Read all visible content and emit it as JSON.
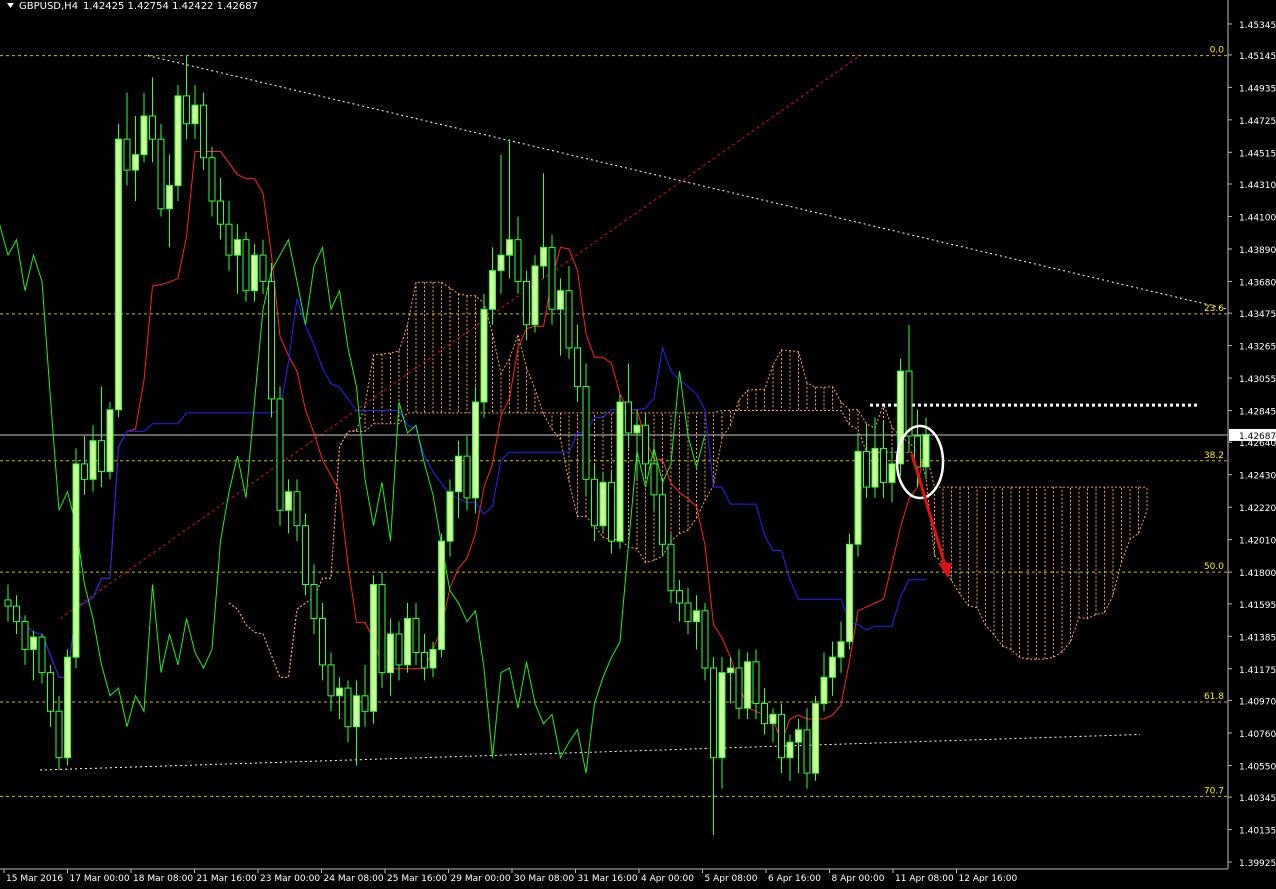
{
  "window": {
    "symbol_label": "GBPUSD,H4",
    "ohlc": "1.42425 1.42754 1.42422 1.42687",
    "collapse_icon": "triangle-down-icon"
  },
  "colors": {
    "background": "#000000",
    "bull_candle": "#ccff99",
    "candle_wick": "#33ff33",
    "tenkan": "#ff2222",
    "kijun": "#2222ff",
    "chikou": "#22ee22",
    "kumo": "#ffa050",
    "fibo": "#ffee00",
    "trendline": "#ffffff",
    "annotation_arrow": "#dd1111",
    "annotation_circle": "#ffffff",
    "price_line": "#c8c8c8"
  },
  "chart_data": {
    "type": "candlestick",
    "timeframe": "H4",
    "ylim": [
      1.3988,
      1.455
    ],
    "price_axis_ticks": [
      "1.45345",
      "1.45145",
      "1.44935",
      "1.44725",
      "1.44515",
      "1.44310",
      "1.44100",
      "1.43890",
      "1.43680",
      "1.43475",
      "1.43265",
      "1.43055",
      "1.42845",
      "1.42640",
      "1.42430",
      "1.42220",
      "1.42010",
      "1.41800",
      "1.41595",
      "1.41385",
      "1.41175",
      "1.40970",
      "1.40760",
      "1.40550",
      "1.40345",
      "1.40135",
      "1.39925"
    ],
    "current_price": {
      "label": "1.42687",
      "value": 1.42687
    },
    "time_axis_ticks": [
      "15 Mar 2016",
      "17 Mar 00:00",
      "18 Mar 08:00",
      "21 Mar 16:00",
      "23 Mar 00:00",
      "24 Mar 08:00",
      "25 Mar 16:00",
      "29 Mar 00:00",
      "30 Mar 08:00",
      "31 Mar 16:00",
      "4 Apr 00:00",
      "5 Apr 08:00",
      "6 Apr 16:00",
      "8 Apr 00:00",
      "11 Apr 08:00",
      "12 Apr 16:00"
    ],
    "fibonacci_levels": [
      {
        "label": "0.0",
        "value": 1.4514
      },
      {
        "label": "23.6",
        "value": 1.4347
      },
      {
        "label": "38.2",
        "value": 1.4252
      },
      {
        "label": "50.0",
        "value": 1.418
      },
      {
        "label": "61.8",
        "value": 1.4096
      },
      {
        "label": "70.7",
        "value": 1.4035
      }
    ],
    "candles": [
      [
        1.4162,
        1.4172,
        1.4148,
        1.4158
      ],
      [
        1.4158,
        1.4165,
        1.414,
        1.4148
      ],
      [
        1.4148,
        1.4152,
        1.412,
        1.413
      ],
      [
        1.413,
        1.4142,
        1.411,
        1.4138
      ],
      [
        1.4138,
        1.414,
        1.4108,
        1.4115
      ],
      [
        1.4115,
        1.412,
        1.408,
        1.409
      ],
      [
        1.409,
        1.41,
        1.4052,
        1.406
      ],
      [
        1.406,
        1.413,
        1.4055,
        1.4125
      ],
      [
        1.4125,
        1.426,
        1.4118,
        1.425
      ],
      [
        1.425,
        1.4268,
        1.423,
        1.424
      ],
      [
        1.424,
        1.4275,
        1.4232,
        1.4265
      ],
      [
        1.4265,
        1.43,
        1.4235,
        1.4245
      ],
      [
        1.4245,
        1.429,
        1.424,
        1.4285
      ],
      [
        1.4285,
        1.447,
        1.428,
        1.446
      ],
      [
        1.446,
        1.449,
        1.443,
        1.444
      ],
      [
        1.444,
        1.4475,
        1.442,
        1.445
      ],
      [
        1.445,
        1.449,
        1.4445,
        1.4475
      ],
      [
        1.4475,
        1.45,
        1.4445,
        1.446
      ],
      [
        1.446,
        1.447,
        1.441,
        1.4415
      ],
      [
        1.4415,
        1.445,
        1.439,
        1.443
      ],
      [
        1.443,
        1.4495,
        1.442,
        1.4488
      ],
      [
        1.4488,
        1.4514,
        1.446,
        1.447
      ],
      [
        1.447,
        1.4495,
        1.446,
        1.4482
      ],
      [
        1.4482,
        1.449,
        1.444,
        1.4448
      ],
      [
        1.4448,
        1.4455,
        1.441,
        1.442
      ],
      [
        1.442,
        1.4435,
        1.4395,
        1.4405
      ],
      [
        1.4405,
        1.442,
        1.4375,
        1.4385
      ],
      [
        1.4385,
        1.4405,
        1.436,
        1.4395
      ],
      [
        1.4395,
        1.44,
        1.4355,
        1.4362
      ],
      [
        1.4362,
        1.4392,
        1.4355,
        1.4385
      ],
      [
        1.4385,
        1.4395,
        1.436,
        1.4368
      ],
      [
        1.4368,
        1.438,
        1.428,
        1.4292
      ],
      [
        1.4292,
        1.43,
        1.421,
        1.422
      ],
      [
        1.422,
        1.424,
        1.4205,
        1.4232
      ],
      [
        1.4232,
        1.424,
        1.42,
        1.421
      ],
      [
        1.421,
        1.4218,
        1.4165,
        1.4172
      ],
      [
        1.4172,
        1.4185,
        1.414,
        1.415
      ],
      [
        1.415,
        1.416,
        1.411,
        1.412
      ],
      [
        1.412,
        1.4128,
        1.409,
        1.41
      ],
      [
        1.41,
        1.4112,
        1.4085,
        1.4105
      ],
      [
        1.4105,
        1.411,
        1.407,
        1.408
      ],
      [
        1.408,
        1.411,
        1.4055,
        1.41
      ],
      [
        1.41,
        1.412,
        1.408,
        1.409
      ],
      [
        1.409,
        1.4178,
        1.4082,
        1.4172
      ],
      [
        1.4172,
        1.418,
        1.4105,
        1.4115
      ],
      [
        1.4115,
        1.415,
        1.41,
        1.414
      ],
      [
        1.414,
        1.4148,
        1.411,
        1.412
      ],
      [
        1.412,
        1.416,
        1.4115,
        1.415
      ],
      [
        1.415,
        1.416,
        1.412,
        1.4128
      ],
      [
        1.4128,
        1.414,
        1.411,
        1.4118
      ],
      [
        1.4118,
        1.4135,
        1.4112,
        1.413
      ],
      [
        1.413,
        1.4205,
        1.4125,
        1.42
      ],
      [
        1.42,
        1.424,
        1.419,
        1.4232
      ],
      [
        1.4232,
        1.4265,
        1.4215,
        1.4255
      ],
      [
        1.4255,
        1.4268,
        1.422,
        1.4228
      ],
      [
        1.4228,
        1.43,
        1.4218,
        1.429
      ],
      [
        1.429,
        1.436,
        1.428,
        1.435
      ],
      [
        1.435,
        1.439,
        1.434,
        1.4375
      ],
      [
        1.4375,
        1.445,
        1.436,
        1.4385
      ],
      [
        1.4385,
        1.446,
        1.437,
        1.4395
      ],
      [
        1.4395,
        1.441,
        1.436,
        1.4368
      ],
      [
        1.4368,
        1.4375,
        1.433,
        1.434
      ],
      [
        1.434,
        1.4385,
        1.4335,
        1.4378
      ],
      [
        1.4378,
        1.4438,
        1.437,
        1.439
      ],
      [
        1.439,
        1.4398,
        1.434,
        1.435
      ],
      [
        1.435,
        1.437,
        1.432,
        1.4362
      ],
      [
        1.4362,
        1.4378,
        1.4318,
        1.4325
      ],
      [
        1.4325,
        1.434,
        1.429,
        1.43
      ],
      [
        1.43,
        1.4315,
        1.423,
        1.424
      ],
      [
        1.424,
        1.425,
        1.42,
        1.421
      ],
      [
        1.421,
        1.4245,
        1.4205,
        1.4238
      ],
      [
        1.4238,
        1.4245,
        1.4192,
        1.42
      ],
      [
        1.42,
        1.4295,
        1.4195,
        1.429
      ],
      [
        1.429,
        1.4315,
        1.426,
        1.427
      ],
      [
        1.427,
        1.4285,
        1.424,
        1.4275
      ],
      [
        1.4275,
        1.4282,
        1.424,
        1.425
      ],
      [
        1.425,
        1.4265,
        1.422,
        1.423
      ],
      [
        1.423,
        1.424,
        1.419,
        1.4198
      ],
      [
        1.4198,
        1.4205,
        1.416,
        1.4168
      ],
      [
        1.4168,
        1.4175,
        1.4148,
        1.416
      ],
      [
        1.416,
        1.417,
        1.414,
        1.4148
      ],
      [
        1.4148,
        1.4165,
        1.413,
        1.4155
      ],
      [
        1.4155,
        1.416,
        1.411,
        1.4118
      ],
      [
        1.4118,
        1.4125,
        1.401,
        1.406
      ],
      [
        1.406,
        1.4125,
        1.404,
        1.4115
      ],
      [
        1.4115,
        1.4125,
        1.4095,
        1.4118
      ],
      [
        1.4118,
        1.413,
        1.4085,
        1.4092
      ],
      [
        1.4092,
        1.4128,
        1.4085,
        1.4122
      ],
      [
        1.4122,
        1.413,
        1.4085,
        1.4095
      ],
      [
        1.4095,
        1.4105,
        1.4075,
        1.4082
      ],
      [
        1.4082,
        1.4092,
        1.407,
        1.4088
      ],
      [
        1.4088,
        1.4095,
        1.405,
        1.406
      ],
      [
        1.406,
        1.4075,
        1.4045,
        1.407
      ],
      [
        1.407,
        1.4085,
        1.405,
        1.4078
      ],
      [
        1.4078,
        1.4092,
        1.404,
        1.405
      ],
      [
        1.405,
        1.41,
        1.4045,
        1.4095
      ],
      [
        1.4095,
        1.4128,
        1.409,
        1.4112
      ],
      [
        1.4112,
        1.4135,
        1.41,
        1.4125
      ],
      [
        1.4125,
        1.4148,
        1.4115,
        1.4135
      ],
      [
        1.4135,
        1.4205,
        1.413,
        1.4198
      ],
      [
        1.4198,
        1.427,
        1.419,
        1.4258
      ],
      [
        1.4258,
        1.4275,
        1.4228,
        1.4235
      ],
      [
        1.4235,
        1.428,
        1.4228,
        1.426
      ],
      [
        1.426,
        1.4278,
        1.4228,
        1.4238
      ],
      [
        1.4238,
        1.426,
        1.4225,
        1.425
      ],
      [
        1.425,
        1.4318,
        1.4242,
        1.431
      ],
      [
        1.431,
        1.434,
        1.4258,
        1.4268
      ],
      [
        1.4268,
        1.4285,
        1.4235,
        1.4248
      ],
      [
        1.4248,
        1.428,
        1.424,
        1.4269
      ]
    ]
  }
}
